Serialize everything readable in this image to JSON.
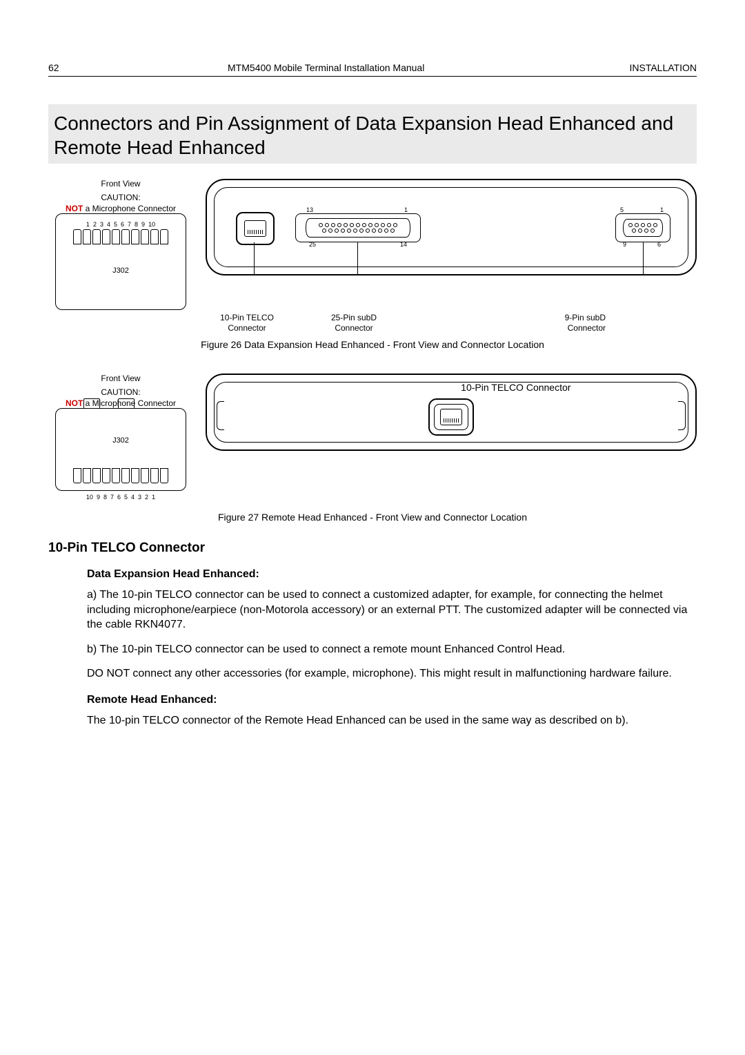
{
  "header": {
    "page_number": "62",
    "doc_title": "MTM5400 Mobile Terminal Installation Manual",
    "section": "INSTALLATION"
  },
  "title": "Connectors and Pin Assignment of Data Expansion Head Enhanced and Remote Head Enhanced",
  "fig26": {
    "front_view": "Front View",
    "caution": "CAUTION:",
    "not_word": "NOT",
    "not_tail": " a Microphone Connector",
    "pins": [
      "1",
      "2",
      "3",
      "4",
      "5",
      "6",
      "7",
      "8",
      "9",
      "10"
    ],
    "j302": "J302",
    "telco_label_1": "10-Pin TELCO",
    "telco_label_2": "Connector",
    "db25_label_1": "25-Pin subD",
    "db25_label_2": "Connector",
    "db9_label_1": "9-Pin subD",
    "db9_label_2": "Connector",
    "pn_13": "13",
    "pn_1a": "1",
    "pn_25": "25",
    "pn_14": "14",
    "pn_5": "5",
    "pn_1b": "1",
    "pn_9": "9",
    "pn_6": "6",
    "caption": "Figure 26  Data Expansion Head Enhanced - Front View and Connector Location"
  },
  "fig27": {
    "front_view": "Front View",
    "caution": "CAUTION:",
    "not_word": "NOT",
    "not_tail": " a Microphone Connector",
    "pins": [
      "10",
      "9",
      "8",
      "7",
      "6",
      "5",
      "4",
      "3",
      "2",
      "1"
    ],
    "j302": "J302",
    "telco_label": "10-Pin TELCO Connector",
    "caption": "Figure 27  Remote Head Enhanced - Front View and Connector Location"
  },
  "section_h2": "10-Pin TELCO Connector",
  "deh_h3": "Data Expansion Head Enhanced:",
  "p_a": "a) The 10-pin TELCO connector can be used to connect a customized adapter, for example, for connecting the helmet including microphone/earpiece (non-Motorola accessory) or an external PTT. The customized adapter will be connected via the cable RKN4077.",
  "p_b": "b) The 10-pin TELCO connector can be used to connect a remote mount Enhanced Control Head.",
  "p_warn": "DO NOT connect any other accessories (for example, microphone). This might result in malfunctioning hardware failure.",
  "rhe_h3": "Remote Head Enhanced:",
  "p_rhe": "The 10-pin TELCO connector of the Remote Head Enhanced can be used in the same way as described on b)."
}
